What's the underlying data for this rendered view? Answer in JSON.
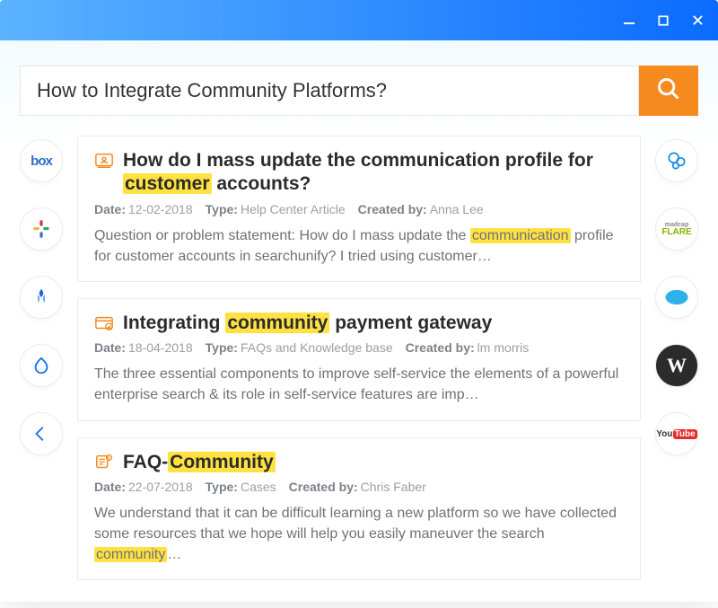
{
  "search": {
    "value": "How to Integrate Community Platforms?",
    "placeholder": "Search…"
  },
  "results": [
    {
      "icon": "person-card-icon",
      "title_html": "How do I mass update the communication profile for <mark>customer</mark> accounts?",
      "date": "12-02-2018",
      "type": "Help Center Article",
      "author": "Anna Lee",
      "snippet_html": "Question or problem statement: How do I mass update the <mark>communication</mark> profile for customer accounts in searchunify? I tried using customer…"
    },
    {
      "icon": "card-check-icon",
      "title_html": "Integrating <mark>community</mark> payment gateway",
      "date": "18-04-2018",
      "type": "FAQs and Knowledge base",
      "author": "lm morris",
      "snippet_html": "The three essential components to improve self-service the elements of a powerful enterprise search & its role in self-service features are imp…"
    },
    {
      "icon": "faq-icon",
      "title_html": "FAQ-<mark>Community</mark>",
      "date": "22-07-2018",
      "type": "Cases",
      "author": "Chris Faber",
      "snippet_html": "We understand that it can be difficult learning a new platform so we have collected some resources that we hope will help you easily maneuver the search <mark>community</mark>…"
    }
  ],
  "left_sources": [
    {
      "name": "box",
      "label": "box"
    },
    {
      "name": "slack",
      "label": ""
    },
    {
      "name": "jira",
      "label": ""
    },
    {
      "name": "drupal",
      "label": ""
    },
    {
      "name": "arrow",
      "label": ""
    }
  ],
  "right_sources": [
    {
      "name": "sharepoint",
      "label": ""
    },
    {
      "name": "flare",
      "label": "madcap FLARE"
    },
    {
      "name": "salesforce",
      "label": ""
    },
    {
      "name": "wordpress",
      "label": "W"
    },
    {
      "name": "youtube",
      "label": "YouTube"
    }
  ],
  "meta_labels": {
    "date": "Date:",
    "type": "Type:",
    "author": "Created by:"
  }
}
